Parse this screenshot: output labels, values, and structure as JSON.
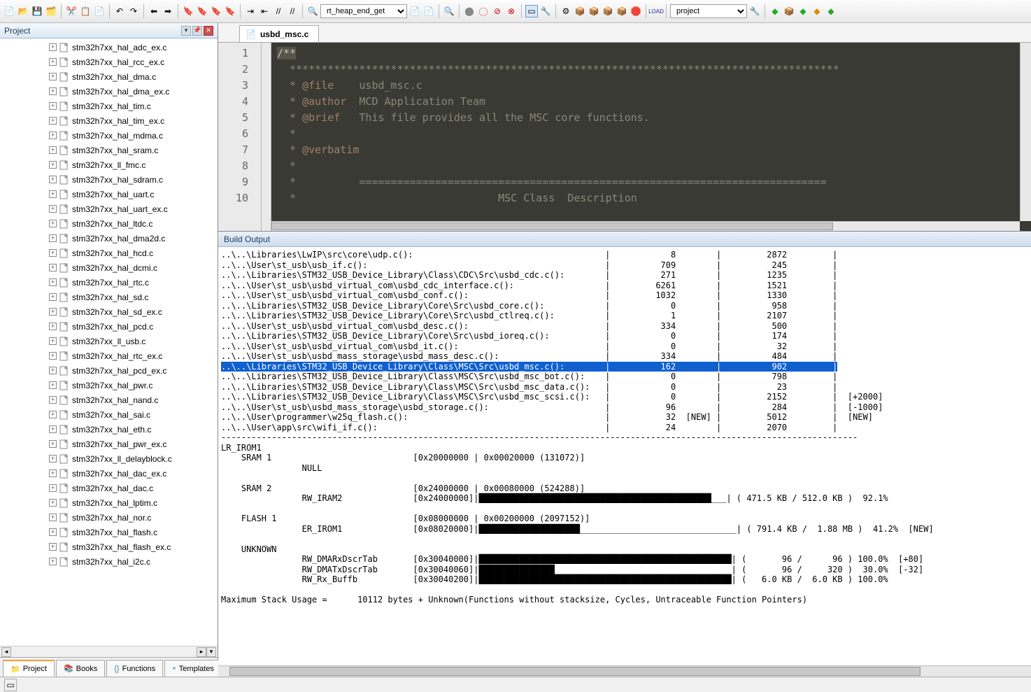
{
  "toolbar": {
    "combo1": "rt_heap_end_get",
    "combo2": "project"
  },
  "project_pane": {
    "title": "Project",
    "files": [
      "stm32h7xx_hal_adc_ex.c",
      "stm32h7xx_hal_rcc_ex.c",
      "stm32h7xx_hal_dma.c",
      "stm32h7xx_hal_dma_ex.c",
      "stm32h7xx_hal_tim.c",
      "stm32h7xx_hal_tim_ex.c",
      "stm32h7xx_hal_mdma.c",
      "stm32h7xx_hal_sram.c",
      "stm32h7xx_ll_fmc.c",
      "stm32h7xx_hal_sdram.c",
      "stm32h7xx_hal_uart.c",
      "stm32h7xx_hal_uart_ex.c",
      "stm32h7xx_hal_ltdc.c",
      "stm32h7xx_hal_dma2d.c",
      "stm32h7xx_hal_hcd.c",
      "stm32h7xx_hal_dcmi.c",
      "stm32h7xx_hal_rtc.c",
      "stm32h7xx_hal_sd.c",
      "stm32h7xx_hal_sd_ex.c",
      "stm32h7xx_hal_pcd.c",
      "stm32h7xx_ll_usb.c",
      "stm32h7xx_hal_rtc_ex.c",
      "stm32h7xx_hal_pcd_ex.c",
      "stm32h7xx_hal_pwr.c",
      "stm32h7xx_hal_nand.c",
      "stm32h7xx_hal_sai.c",
      "stm32h7xx_hal_eth.c",
      "stm32h7xx_hal_pwr_ex.c",
      "stm32h7xx_ll_delayblock.c",
      "stm32h7xx_hal_dac_ex.c",
      "stm32h7xx_hal_dac.c",
      "stm32h7xx_hal_lptim.c",
      "stm32h7xx_hal_nor.c",
      "stm32h7xx_hal_flash.c",
      "stm32h7xx_hal_flash_ex.c",
      "stm32h7xx_hal_i2c.c"
    ],
    "tabs": [
      "Project",
      "Books",
      "Functions",
      "Templates"
    ]
  },
  "editor": {
    "tab": "usbd_msc.c",
    "lines": {
      "l1": "/**",
      "l2": "  ***************************************************************************************",
      "l3_a": "  * ",
      "l3_kw": "@file   ",
      "l3_b": " usbd_msc.c",
      "l4_a": "  * ",
      "l4_kw": "@author ",
      "l4_b": " MCD Application Team",
      "l5_a": "  * ",
      "l5_kw": "@brief  ",
      "l5_b": " This file provides all the MSC core functions.",
      "l6": "  *",
      "l7_a": "  * ",
      "l7_kw": "@verbatim",
      "l8": "  *",
      "l9": "  *          ==========================================================================",
      "l10": "  *                                MSC Class  Description"
    }
  },
  "build": {
    "title": "Build Output",
    "rows": [
      {
        "path": "..\\..\\Libraries\\LwIP\\src\\core\\udp.c():",
        "c1": "8",
        "c2": "2872",
        "ex": ""
      },
      {
        "path": "..\\..\\User\\st_usb\\usb_if.c():",
        "c1": "709",
        "c2": "245",
        "ex": ""
      },
      {
        "path": "..\\..\\Libraries\\STM32_USB_Device_Library\\Class\\CDC\\Src\\usbd_cdc.c():",
        "c1": "271",
        "c2": "1235",
        "ex": ""
      },
      {
        "path": "..\\..\\User\\st_usb\\usbd_virtual_com\\usbd_cdc_interface.c():",
        "c1": "6261",
        "c2": "1521",
        "ex": ""
      },
      {
        "path": "..\\..\\User\\st_usb\\usbd_virtual_com\\usbd_conf.c():",
        "c1": "1032",
        "c2": "1330",
        "ex": ""
      },
      {
        "path": "..\\..\\Libraries\\STM32_USB_Device_Library\\Core\\Src\\usbd_core.c():",
        "c1": "0",
        "c2": "958",
        "ex": ""
      },
      {
        "path": "..\\..\\Libraries\\STM32_USB_Device_Library\\Core\\Src\\usbd_ctlreq.c():",
        "c1": "1",
        "c2": "2107",
        "ex": ""
      },
      {
        "path": "..\\..\\User\\st_usb\\usbd_virtual_com\\usbd_desc.c():",
        "c1": "334",
        "c2": "500",
        "ex": ""
      },
      {
        "path": "..\\..\\Libraries\\STM32_USB_Device_Library\\Core\\Src\\usbd_ioreq.c():",
        "c1": "0",
        "c2": "174",
        "ex": ""
      },
      {
        "path": "..\\..\\User\\st_usb\\usbd_virtual_com\\usbd_it.c():",
        "c1": "0",
        "c2": "32",
        "ex": ""
      },
      {
        "path": "..\\..\\User\\st_usb\\usbd_mass_storage\\usbd_mass_desc.c():",
        "c1": "334",
        "c2": "484",
        "ex": ""
      },
      {
        "path": "..\\..\\Libraries\\STM32_USB_Device_Library\\Class\\MSC\\Src\\usbd_msc.c():",
        "c1": "162",
        "c2": "902",
        "ex": "",
        "hl": true
      },
      {
        "path": "..\\..\\Libraries\\STM32_USB_Device_Library\\Class\\MSC\\Src\\usbd_msc_bot.c():",
        "c1": "0",
        "c2": "798",
        "ex": ""
      },
      {
        "path": "..\\..\\Libraries\\STM32_USB_Device_Library\\Class\\MSC\\Src\\usbd_msc_data.c():",
        "c1": "0",
        "c2": "23",
        "ex": ""
      },
      {
        "path": "..\\..\\Libraries\\STM32_USB_Device_Library\\Class\\MSC\\Src\\usbd_msc_scsi.c():",
        "c1": "0",
        "c2": "2152",
        "ex": "[+2000]"
      },
      {
        "path": "..\\..\\User\\st_usb\\usbd_mass_storage\\usbd_storage.c():",
        "c1": "96",
        "c2": "284",
        "ex": "[-1000]"
      },
      {
        "path": "..\\..\\User\\programmer\\w25q_flash.c():",
        "c1": "32",
        "c1ex": "[NEW]",
        "c2": "5012",
        "ex": "[NEW]"
      },
      {
        "path": "..\\..\\User\\app\\src\\wifi_if.c():",
        "c1": "24",
        "c2": "2070",
        "ex": ""
      }
    ],
    "divider": "------------------------------------------------------------------------------------------------------------------------------",
    "lr_irom": "LR_IROM1",
    "mem": {
      "sram1": "    SRAM 1                            [0x20000000 | 0x00020000 (131072)]",
      "null": "                NULL",
      "sram2": "    SRAM 2                            [0x24000000 | 0x00080000 (524288)]",
      "rwiram": "                RW_IRAM2              [0x24000000]|██████████████████████████████████████████████___| ( 471.5 KB / 512.0 KB )  92.1%",
      "flash1": "    FLASH 1                           [0x08000000 | 0x00200000 (2097152)]",
      "erirom": "                ER_IROM1              [0x08020000]|████████████████████_______________________________| ( 791.4 KB /  1.88 MB )  41.2%  [NEW]",
      "unknown": "    UNKNOWN",
      "rwdmarx": "                RW_DMARxDscrTab       [0x30040000]|██████████████████████████████████████████████████| (       96 /      96 ) 100.0%  [+80]",
      "rwdmatx": "                RW_DMATxDscrTab       [0x30040060]|███████████████___________________________________| (       96 /     320 )  30.0%  [-32]",
      "rwrxbuf": "                RW_Rx_Buffb           [0x30040200]|██████████████████████████████████████████████████| (   6.0 KB /  6.0 KB ) 100.0%"
    },
    "maxstack": "Maximum Stack Usage =      10112 bytes + Unknown(Functions without stacksize, Cycles, Untraceable Function Pointers)"
  }
}
